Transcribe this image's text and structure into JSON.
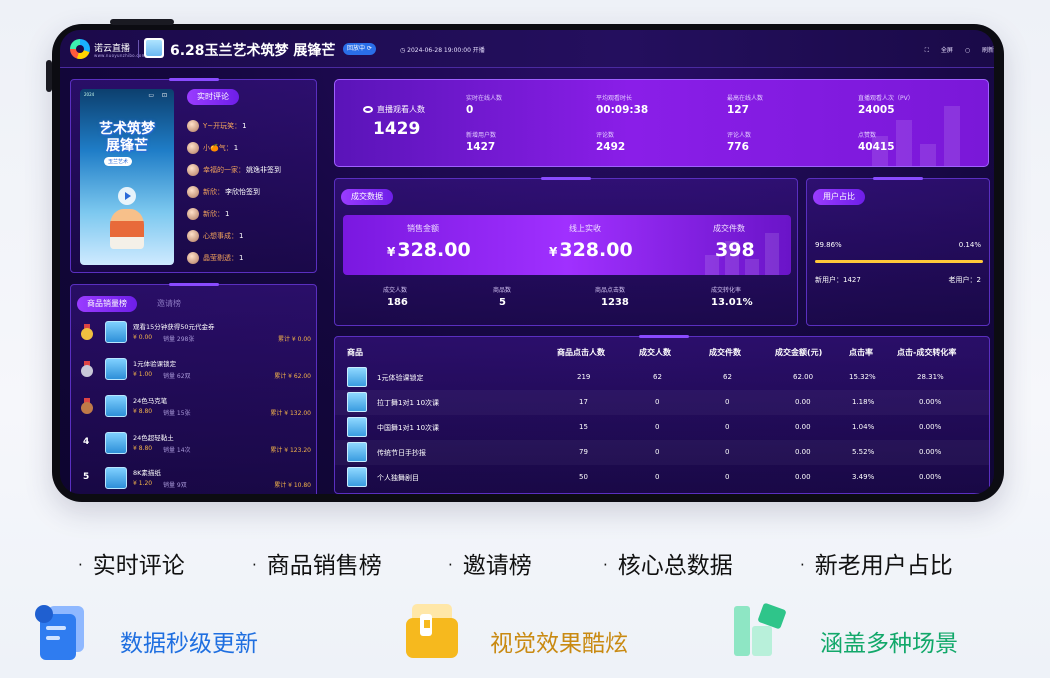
{
  "topbar": {
    "brand": "诺云直播",
    "brand_sub": "www.nuoyunzhibo.com",
    "title": "6.28玉兰艺术筑梦 展锋芒",
    "live_badge": "回放中",
    "start_time": "2024-06-28 19:00:00 开播",
    "fullscreen_label": "全屏",
    "refresh_label": "刷新"
  },
  "comments": {
    "tab_label": "实时评论",
    "poster": {
      "title_line1": "艺术筑梦",
      "title_line2": "展锋芒",
      "tag": "玉兰艺术"
    },
    "items": [
      {
        "name": "Y~开玩笑：",
        "text": "1"
      },
      {
        "name": "小🍊气：",
        "text": "1"
      },
      {
        "name": "幸福的一家：",
        "text": "姚逸非签到"
      },
      {
        "name": "新欣：",
        "text": "李欣怡签到"
      },
      {
        "name": "新欣：",
        "text": "1"
      },
      {
        "name": "心想事成：",
        "text": "1"
      },
      {
        "name": "晶莹剔透：",
        "text": "1"
      }
    ]
  },
  "ranking": {
    "tab_active": "商品销量榜",
    "tab_inactive": "邀请榜",
    "items": [
      {
        "rank": "1",
        "name": "观看15分钟获得50元代金券",
        "price": "¥ 0.00",
        "sales": "销量 298张",
        "total": "累计 ¥ 0.00"
      },
      {
        "rank": "2",
        "name": "1元体验课锁定",
        "price": "¥ 1.00",
        "sales": "销量 62双",
        "total": "累计 ¥ 62.00"
      },
      {
        "rank": "3",
        "name": "24色马克笔",
        "price": "¥ 8.80",
        "sales": "销量 15张",
        "total": "累计 ¥ 132.00"
      },
      {
        "rank": "4",
        "name": "24色超轻黏土",
        "price": "¥ 8.80",
        "sales": "销量 14次",
        "total": "累计 ¥ 123.20"
      },
      {
        "rank": "5",
        "name": "8K素描纸",
        "price": "¥ 1.20",
        "sales": "销量 9双",
        "total": "累计 ¥ 10.80"
      }
    ]
  },
  "core": {
    "main_label": "直播观看人数",
    "main_value": "1429",
    "stats": [
      {
        "label": "实时在线人数",
        "value": "0"
      },
      {
        "label": "平均观看时长",
        "value": "00:09:38"
      },
      {
        "label": "最高在线人数",
        "value": "127"
      },
      {
        "label": "直播观看人次（PV）",
        "value": "24005"
      },
      {
        "label": "新增用户数",
        "value": "1427"
      },
      {
        "label": "评论数",
        "value": "2492"
      },
      {
        "label": "评论人数",
        "value": "776"
      },
      {
        "label": "点赞数",
        "value": "40415"
      }
    ]
  },
  "deals": {
    "tab_label": "成交数据",
    "big": [
      {
        "label": "销售金额",
        "currency": "¥",
        "value": "328.00"
      },
      {
        "label": "线上实收",
        "currency": "¥",
        "value": "328.00"
      },
      {
        "label": "成交件数",
        "currency": "",
        "value": "398"
      }
    ],
    "small": [
      {
        "label": "成交人数",
        "value": "186"
      },
      {
        "label": "商品数",
        "value": "5"
      },
      {
        "label": "商品点击数",
        "value": "1238"
      },
      {
        "label": "成交转化率",
        "value": "13.01%"
      }
    ]
  },
  "user_share": {
    "tab_label": "用户占比",
    "new_pct": "99.86%",
    "old_pct": "0.14%",
    "new_fraction": 0.9986,
    "new_users": "新用户：1427",
    "old_users": "老用户：2",
    "bar_color": "#ffc83a"
  },
  "product_table": {
    "headers": [
      "商品",
      "商品点击人数",
      "成交人数",
      "成交件数",
      "成交金额(元)",
      "点击率",
      "点击-成交转化率"
    ],
    "rows": [
      [
        "1元体验课锁定",
        "219",
        "62",
        "62",
        "62.00",
        "15.32%",
        "28.31%"
      ],
      [
        "拉丁舞1对1 10次课",
        "17",
        "0",
        "0",
        "0.00",
        "1.18%",
        "0.00%"
      ],
      [
        "中国舞1对1 10次课",
        "15",
        "0",
        "0",
        "0.00",
        "1.04%",
        "0.00%"
      ],
      [
        "传统节日手抄报",
        "79",
        "0",
        "0",
        "0.00",
        "5.52%",
        "0.00%"
      ],
      [
        "个人独舞剧目",
        "50",
        "0",
        "0",
        "0.00",
        "3.49%",
        "0.00%"
      ]
    ]
  },
  "features": [
    "实时评论",
    "商品销售榜",
    "邀请榜",
    "核心总数据",
    "新老用户占比"
  ],
  "highlights": [
    {
      "label": "数据秒级更新",
      "color": "#1f6fe0",
      "icon": "document-icon"
    },
    {
      "label": "视觉效果酷炫",
      "color": "#c98a12",
      "icon": "folder-icon"
    },
    {
      "label": "涵盖多种场景",
      "color": "#12a86a",
      "icon": "blocks-icon"
    }
  ],
  "colors": {
    "accent_purple": "#8a1ee8",
    "panel_border": "#5a2fc0",
    "highlight_gold": "#f5b54a",
    "comment_name": "#f2a35c"
  }
}
